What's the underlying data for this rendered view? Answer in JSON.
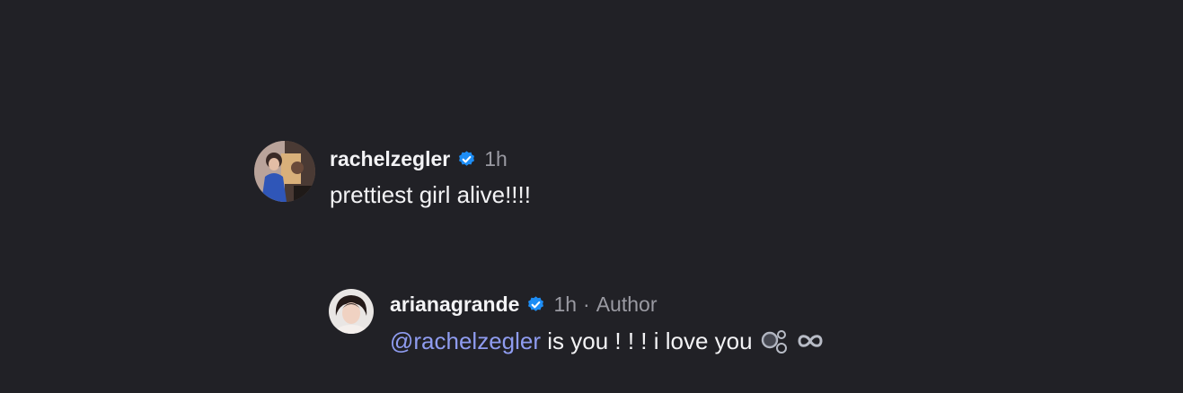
{
  "comments": [
    {
      "username": "rachelzegler",
      "time": "1h",
      "text": "prettiest girl alive!!!!"
    },
    {
      "username": "arianagrande",
      "time": "1h",
      "separator": "·",
      "author_label": "Author",
      "mention": "@rachelzegler",
      "text": "is you ! ! ! i love you",
      "emoji_icons": [
        "bubbles-icon",
        "infinity-icon"
      ]
    }
  ],
  "colors": {
    "background": "#212126",
    "text": "#f3f3f5",
    "secondary": "#9a9aa2",
    "mention": "#8f9cf0",
    "verified": "#1d8df5"
  },
  "icons": {
    "verified": "verified-badge-icon"
  }
}
